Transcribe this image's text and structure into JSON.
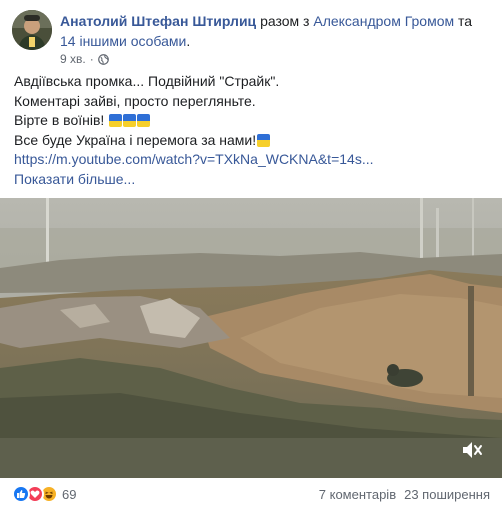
{
  "post": {
    "author": "Анатолий Штефан Штирлиц",
    "with_prefix": "разом з",
    "tagged": "Александром Громом",
    "and_text": "та",
    "others": "14 іншими особами",
    "trailing_dot": ".",
    "time": "9 хв.",
    "separator": "·",
    "privacy_icon": "globe-icon",
    "lines": [
      "Авдіївська промка... Подвійний \"Страйк\".",
      "Коментарі зайві, просто перегляньте.",
      "Вірте в воїнів!",
      "Все буде Україна і перемога за нами!"
    ],
    "url": "https://m.youtube.com/watch?v=TXkNa_WCKNA&t=14s...",
    "see_more": "Показати більше..."
  },
  "footer": {
    "reaction_icons": [
      "like-icon",
      "love-icon",
      "haha-icon"
    ],
    "reactions_count": "69",
    "comments": "7 коментарів",
    "shares": "23 поширення"
  },
  "colors": {
    "link": "#385898",
    "secondary": "#616770",
    "like": "#1877f2",
    "love": "#f33e58",
    "haha": "#f7b125",
    "flag_blue": "#2f6fd6",
    "flag_yellow": "#f6cf2a"
  }
}
